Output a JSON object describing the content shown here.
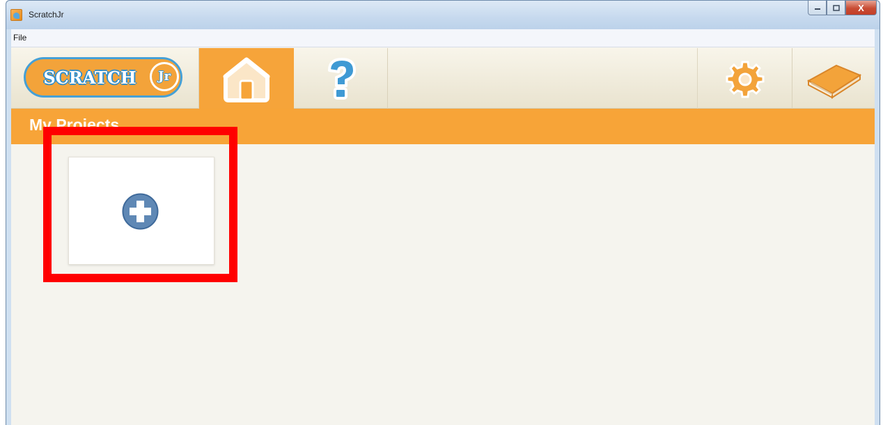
{
  "window": {
    "title": "ScratchJr",
    "controls": {
      "minimize": "—",
      "maximize": "□",
      "close": "X"
    }
  },
  "menu": {
    "file": "File"
  },
  "topbar": {
    "logo_text": "SCRATCH",
    "logo_jr": "Jr",
    "tabs": [
      {
        "name": "home",
        "icon": "home-icon",
        "selected": true
      },
      {
        "name": "help",
        "icon": "question-icon",
        "selected": false
      },
      {
        "name": "settings",
        "icon": "gear-icon",
        "selected": false
      },
      {
        "name": "book",
        "icon": "book-icon",
        "selected": false
      }
    ]
  },
  "header": {
    "title": "My Projects"
  },
  "projects": {
    "new_project_icon": "plus-icon"
  },
  "colors": {
    "accent_orange": "#f7a438",
    "highlight_red": "#ff0000",
    "plus_blue": "#5f88b5"
  }
}
